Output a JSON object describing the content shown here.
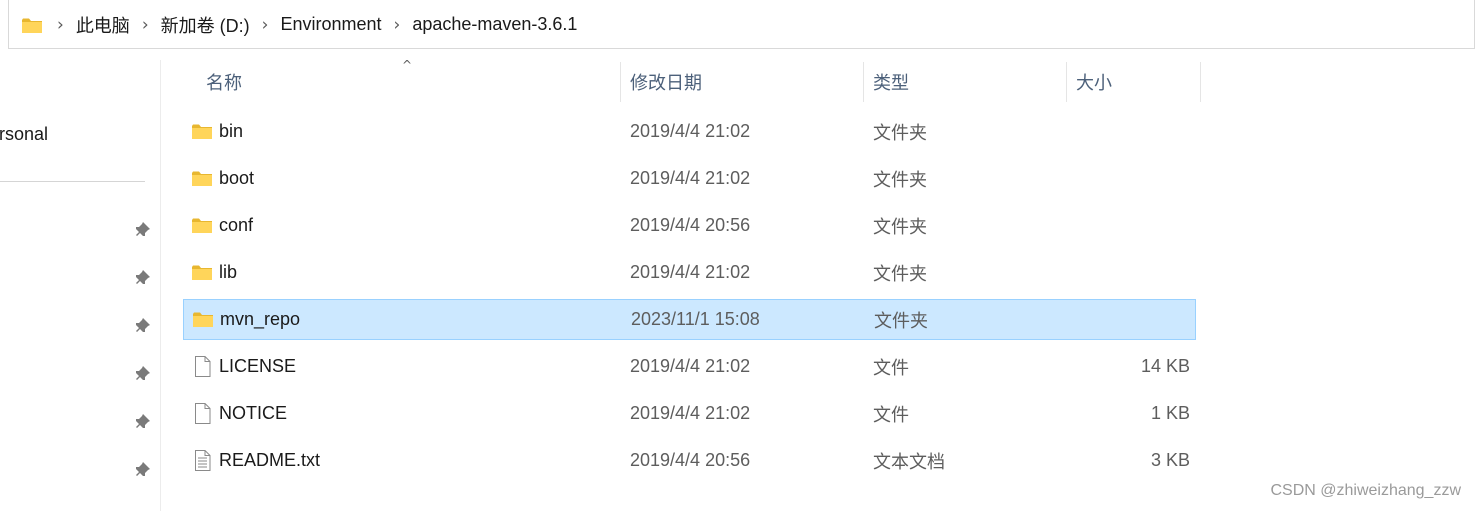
{
  "breadcrumb": {
    "separator": "›",
    "items": [
      "此电脑",
      "新加卷 (D:)",
      "Environment",
      "apache-maven-3.6.1"
    ]
  },
  "nav": {
    "label": "rsonal"
  },
  "columns": {
    "name": "名称",
    "modified": "修改日期",
    "type": "类型",
    "size": "大小",
    "sort_indicator": "^"
  },
  "files": [
    {
      "name": "bin",
      "modified": "2019/4/4 21:02",
      "type": "文件夹",
      "size": "",
      "icon": "folder-icon"
    },
    {
      "name": "boot",
      "modified": "2019/4/4 21:02",
      "type": "文件夹",
      "size": "",
      "icon": "folder-icon"
    },
    {
      "name": "conf",
      "modified": "2019/4/4 20:56",
      "type": "文件夹",
      "size": "",
      "icon": "folder-icon"
    },
    {
      "name": "lib",
      "modified": "2019/4/4 21:02",
      "type": "文件夹",
      "size": "",
      "icon": "folder-icon"
    },
    {
      "name": "mvn_repo",
      "modified": "2023/11/1 15:08",
      "type": "文件夹",
      "size": "",
      "icon": "folder-icon",
      "selected": true
    },
    {
      "name": "LICENSE",
      "modified": "2019/4/4 21:02",
      "type": "文件",
      "size": "14 KB",
      "icon": "file-icon"
    },
    {
      "name": "NOTICE",
      "modified": "2019/4/4 21:02",
      "type": "文件",
      "size": "1 KB",
      "icon": "file-icon"
    },
    {
      "name": "README.txt",
      "modified": "2019/4/4 20:56",
      "type": "文本文档",
      "size": "3 KB",
      "icon": "text-file-icon"
    }
  ],
  "watermark": "CSDN @zhiweizhang_zzw",
  "colors": {
    "selection_bg": "#cce8ff",
    "selection_border": "#99d1ff",
    "folder_yellow": "#ffd55a",
    "folder_dark": "#e8b730",
    "header_text": "#4c607a"
  }
}
